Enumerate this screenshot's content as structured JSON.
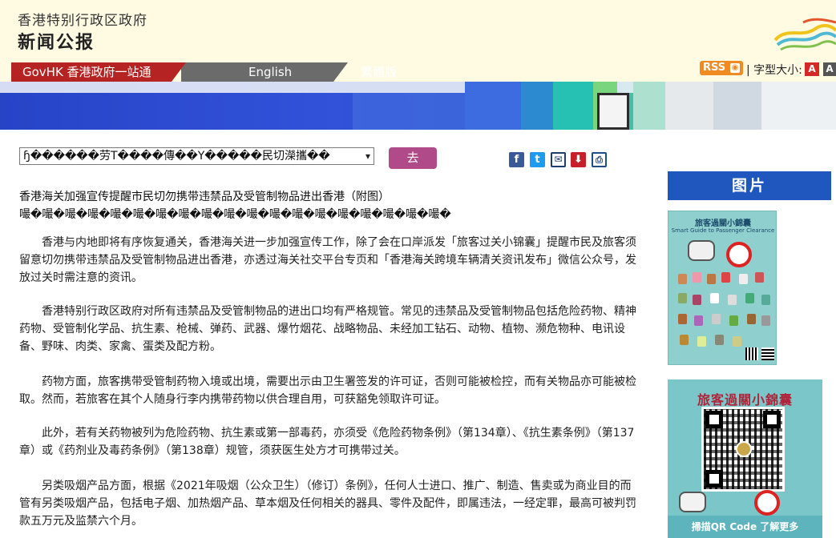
{
  "header": {
    "gov_name": "香港特别行政区政府",
    "press_title": "新闻公报"
  },
  "nav": {
    "govhk": "GovHK 香港政府一站通",
    "traditional": "繁體版",
    "english": "English"
  },
  "tools": {
    "rss": "RSS",
    "font_size_label": "| 字型大小:",
    "font_a_small": "A",
    "font_a_large": "A"
  },
  "selector": {
    "value": "ɧ������劳T����傳��Y�����民切濚攜��",
    "go": "去"
  },
  "share_icons": [
    "facebook-icon",
    "twitter-icon",
    "email-icon",
    "save-icon",
    "print-icon"
  ],
  "article": {
    "title": "香港海关加强宣传提醒市民切勿携带违禁品及受管制物品进出香港（附图）",
    "garbled": "嘬�嘬�嘬�嘬�嘬�嘬�嘬�嘬�嘬�嘬�嘬�嘬�嘬�嘬�嘬�嘬�嘬�嘬�嘬�",
    "paragraphs": [
      "香港与内地即将有序恢复通关，香港海关进一步加强宣传工作，除了会在口岸派发「旅客过关小锦囊」提醒市民及旅客须留意切勿携带违禁品及受管制物品进出香港，亦透过海关社交平台专页和「香港海关跨境车辆清关资讯发布」微信公众号，发放过关时需注意的资讯。",
      "香港特别行政区政府对所有违禁品及受管制物品的进出口均有严格规管。常见的违禁品及受管制物品包括危险药物、精神药物、受管制化学品、抗生素、枪械、弹药、武器、爆竹烟花、战略物品、未经加工钻石、动物、植物、濒危物种、电讯设备、野味、肉类、家禽、蛋类及配方粉。",
      "药物方面，旅客携带受管制药物入境或出境，需要出示由卫生署签发的许可证，否则可能被检控，而有关物品亦可能被检取。然而，若旅客在其个人随身行李内携带药物以供合理自用，可获豁免领取许可证。",
      "此外，若有关药物被列为危险药物、抗生素或第一部毒药，亦须受《危险药物条例》（第134章）、《抗生素条例》（第137章）或《药剂业及毒药条例》（第138章）规管，须获医生处方才可携带过关。",
      "另类吸烟产品方面，根据《2021年吸烟（公众卫生）（修订）条例》，任何人士进口、推广、制造、售卖或为商业目的而管有另类吸烟产品，包括电子烟、加热烟产品、草本烟及任何相关的器具、零件及配件，即属违法，一经定罪，最高可被判罚款五万元及监禁六个月。"
    ]
  },
  "sidebar": {
    "header": "图片",
    "poster1": {
      "title": "旅客過關小錦囊",
      "subtitle": "Smart Guide to Passenger Clearance"
    },
    "poster2": {
      "title": "旅客過關小錦囊",
      "footer": "掃描QR Code 了解更多"
    }
  },
  "colors": {
    "accent_red": "#b52423",
    "go_button": "#b14a89",
    "picture_header": "#2057be"
  }
}
